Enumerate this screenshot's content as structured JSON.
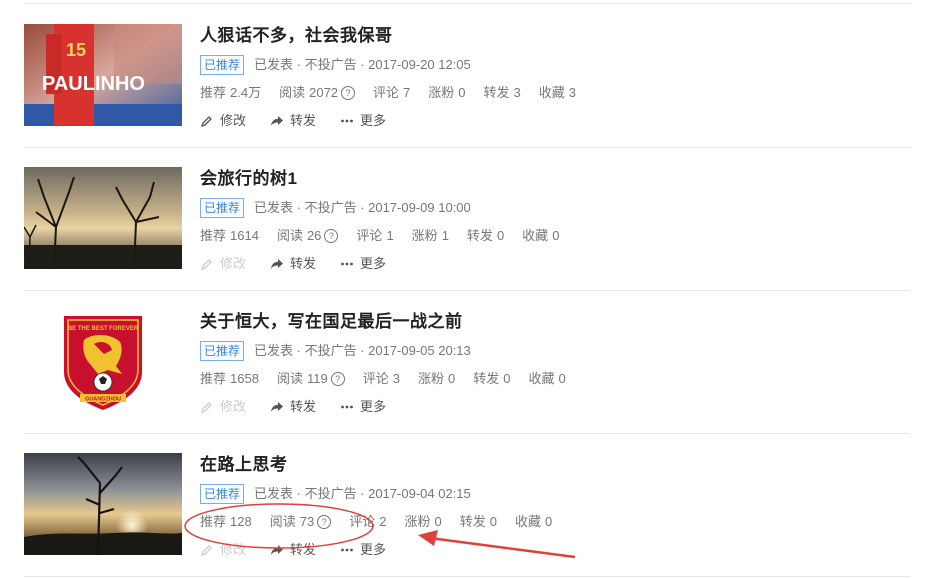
{
  "articles": [
    {
      "title": "人狠话不多，社会我保哥",
      "badge": "已推荐",
      "status": "已发表 · 不投广告 · 2017-09-20 12:05",
      "thumb_text": "PAULINHO",
      "thumb_number": "15",
      "stats": [
        {
          "label": "推荐",
          "value": "2.4万"
        },
        {
          "label": "阅读",
          "value": "2072",
          "help": true
        },
        {
          "label": "评论",
          "value": "7"
        },
        {
          "label": "涨粉",
          "value": "0"
        },
        {
          "label": "转发",
          "value": "3"
        },
        {
          "label": "收藏",
          "value": "3"
        }
      ],
      "actions": {
        "edit": "修改",
        "forward": "转发",
        "more": "更多"
      },
      "edit_enabled": true
    },
    {
      "title": "会旅行的树1",
      "badge": "已推荐",
      "status": "已发表 · 不投广告 · 2017-09-09 10:00",
      "stats": [
        {
          "label": "推荐",
          "value": "1614"
        },
        {
          "label": "阅读",
          "value": "26",
          "help": true
        },
        {
          "label": "评论",
          "value": "1"
        },
        {
          "label": "涨粉",
          "value": "1"
        },
        {
          "label": "转发",
          "value": "0"
        },
        {
          "label": "收藏",
          "value": "0"
        }
      ],
      "actions": {
        "edit": "修改",
        "forward": "转发",
        "more": "更多"
      },
      "edit_enabled": false
    },
    {
      "title": "关于恒大，写在国足最后一战之前",
      "badge": "已推荐",
      "status": "已发表 · 不投广告 · 2017-09-05 20:13",
      "logo_top": "BE THE BEST FOREVER",
      "logo_bottom": "GUANGZHOU",
      "stats": [
        {
          "label": "推荐",
          "value": "1658"
        },
        {
          "label": "阅读",
          "value": "119",
          "help": true
        },
        {
          "label": "评论",
          "value": "3"
        },
        {
          "label": "涨粉",
          "value": "0"
        },
        {
          "label": "转发",
          "value": "0"
        },
        {
          "label": "收藏",
          "value": "0"
        }
      ],
      "actions": {
        "edit": "修改",
        "forward": "转发",
        "more": "更多"
      },
      "edit_enabled": false
    },
    {
      "title": "在路上思考",
      "badge": "已推荐",
      "status": "已发表 · 不投广告 · 2017-09-04 02:15",
      "stats": [
        {
          "label": "推荐",
          "value": "128"
        },
        {
          "label": "阅读",
          "value": "73",
          "help": true
        },
        {
          "label": "评论",
          "value": "2"
        },
        {
          "label": "涨粉",
          "value": "0"
        },
        {
          "label": "转发",
          "value": "0"
        },
        {
          "label": "收藏",
          "value": "0"
        }
      ],
      "actions": {
        "edit": "修改",
        "forward": "转发",
        "more": "更多"
      },
      "edit_enabled": false
    }
  ],
  "colors": {
    "badge": "#3e86d8",
    "annotation": "#e0403a",
    "text_muted": "#777777"
  }
}
